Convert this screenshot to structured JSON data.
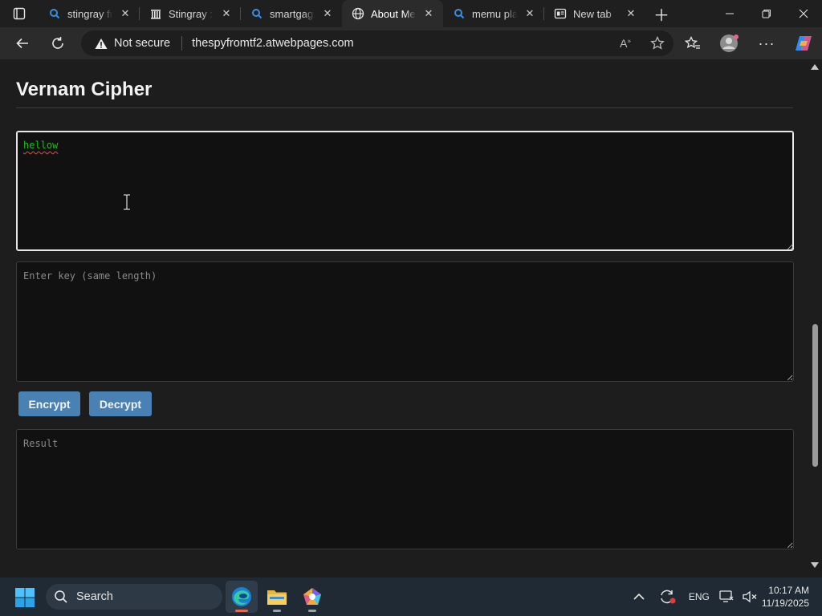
{
  "browser": {
    "tabs": [
      {
        "label": "stingray fnaf",
        "icon": "search-icon",
        "active": false
      },
      {
        "label": "Stingray : Fr",
        "icon": "archive-icon",
        "active": false
      },
      {
        "label": "smartgaga",
        "icon": "search-icon",
        "active": false
      },
      {
        "label": "About Me -",
        "icon": "globe-icon",
        "active": true
      },
      {
        "label": "memu play",
        "icon": "search-icon",
        "active": false
      },
      {
        "label": "New tab",
        "icon": "newtab-icon",
        "active": false
      }
    ],
    "security_label": "Not secure",
    "url": "thespyfromtf2.atwebpages.com"
  },
  "page": {
    "title": "Vernam Cipher",
    "plaintext": {
      "value": "hellow",
      "placeholder": ""
    },
    "key": {
      "value": "",
      "placeholder": "Enter key (same length)"
    },
    "encrypt_label": "Encrypt",
    "decrypt_label": "Decrypt",
    "result": {
      "value": "",
      "placeholder": "Result"
    }
  },
  "taskbar": {
    "search_label": "Search",
    "language": "ENG",
    "time": "10:17 AM",
    "date": "11/19/2025"
  },
  "colors": {
    "button": "#4a81b5",
    "input_text": "#19c119",
    "page_bg": "#1d1d1d",
    "textarea_bg": "#111111"
  }
}
